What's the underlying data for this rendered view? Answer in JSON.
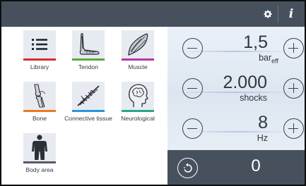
{
  "toolbar": {
    "settings_icon": "gear-icon",
    "info_icon": "info-icon",
    "info_label": "i"
  },
  "library": {
    "items": [
      {
        "label": "Library",
        "icon": "list-icon",
        "color": "#d92b2b"
      },
      {
        "label": "Tendon",
        "icon": "tendon-foot-icon",
        "color": "#5aa83a"
      },
      {
        "label": "Muscle",
        "icon": "muscle-icon",
        "color": "#b03aa8"
      },
      {
        "label": "Bone",
        "icon": "knee-bone-icon",
        "color": "#ef7a1c"
      },
      {
        "label": "Connective tissue",
        "icon": "connective-tissue-icon",
        "color": "#2a96d8"
      },
      {
        "label": "Neurological",
        "icon": "head-brain-icon",
        "color": "#2aa58e"
      },
      {
        "label": "Body area",
        "icon": "body-silhouette-icon",
        "color": "#555b66"
      }
    ]
  },
  "params": {
    "pressure": {
      "value": "1,5",
      "unit": "bar",
      "unit_sub": "eff"
    },
    "shocks": {
      "value": "2.000",
      "unit": "shocks"
    },
    "frequency": {
      "value": "8",
      "unit": "Hz"
    }
  },
  "counter": {
    "value": "0",
    "reset_icon": "reset-counter-icon"
  }
}
